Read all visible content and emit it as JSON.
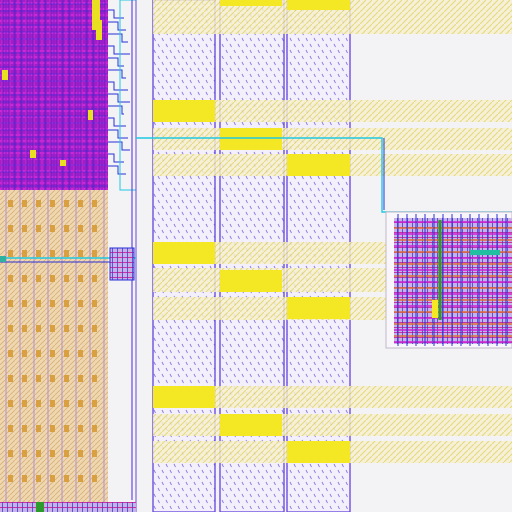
{
  "viewer": {
    "colors": {
      "background": "#f3f3f6",
      "metal_purple": "#8a1fd0",
      "metal_magenta": "#d020d0",
      "metal_blue": "#2830d8",
      "route_cyan": "#20c8e0",
      "pad_yellow": "#f4e824",
      "hatch_yellow": "#e8dc6a",
      "diff_tan": "#e8c890",
      "poly_green": "#2c9a2c",
      "column_border": "#6a4adf",
      "stipple": "#7a68d8"
    },
    "layers": [
      {
        "icon": "metal-layer-icon",
        "color": "#8a1fd0"
      },
      {
        "icon": "poly-layer-icon",
        "color": "#2c9a2c"
      },
      {
        "icon": "via-layer-icon",
        "color": "#20c8e0"
      }
    ]
  }
}
